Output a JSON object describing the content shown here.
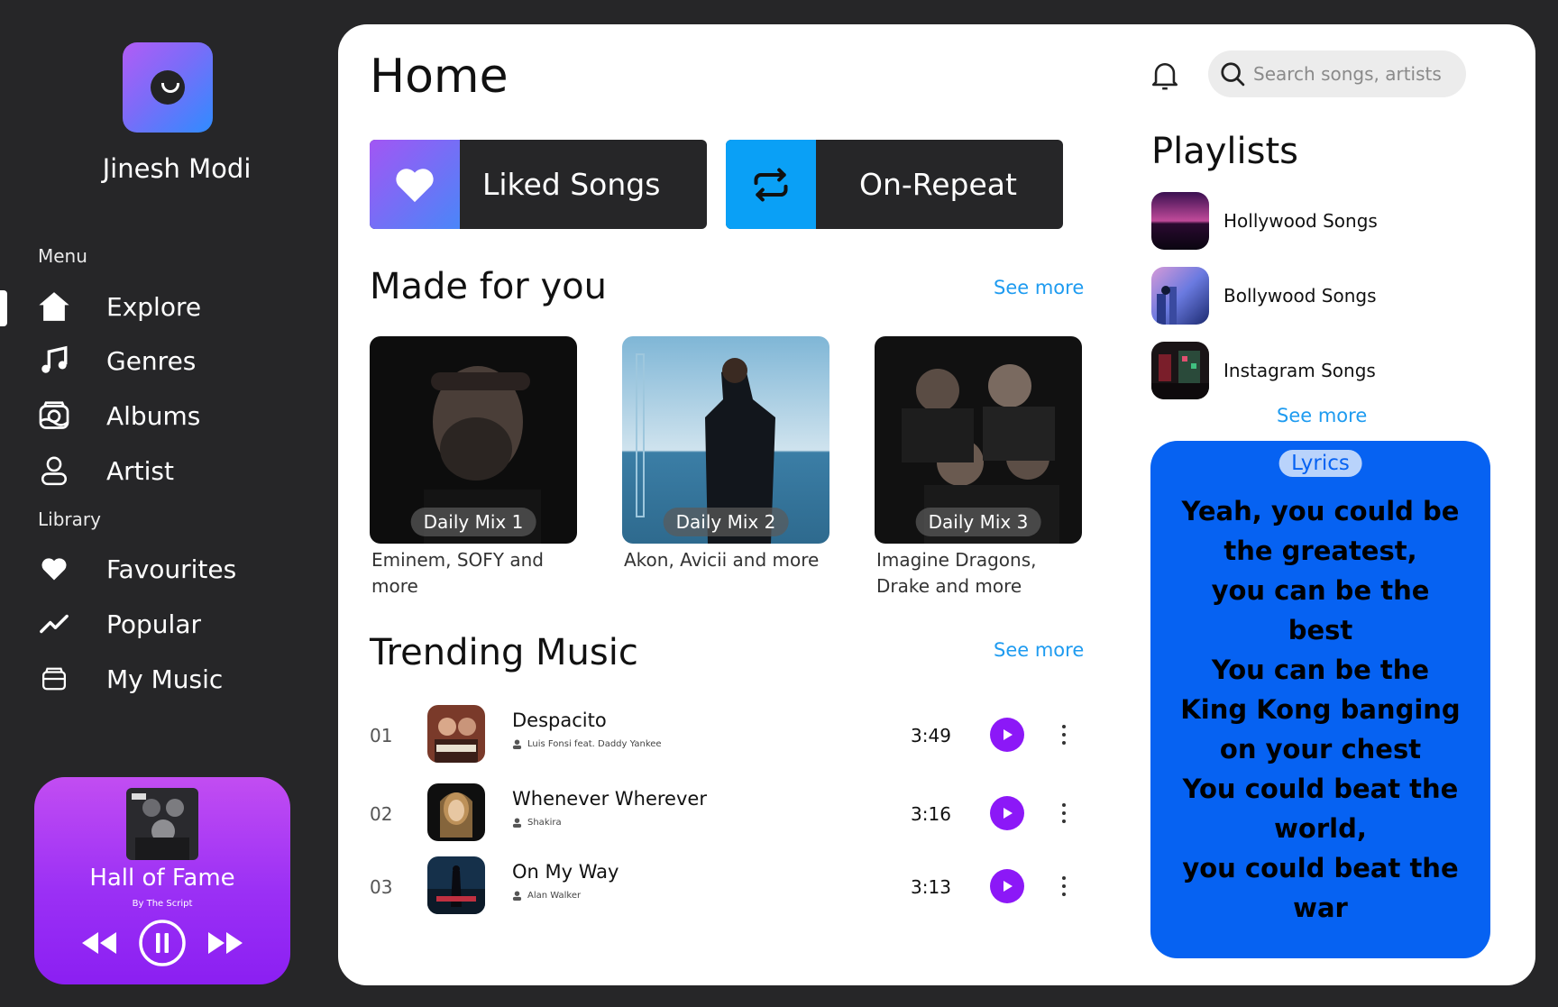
{
  "user": {
    "name": "Jinesh Modi"
  },
  "menu": {
    "label": "Menu",
    "items": [
      {
        "label": "Explore",
        "icon": "home-icon"
      },
      {
        "label": "Genres",
        "icon": "music-note-icon"
      },
      {
        "label": "Albums",
        "icon": "album-icon"
      },
      {
        "label": "Artist",
        "icon": "user-icon"
      }
    ]
  },
  "library": {
    "label": "Library",
    "items": [
      {
        "label": "Favourites",
        "icon": "heart-icon"
      },
      {
        "label": "Popular",
        "icon": "trend-icon"
      },
      {
        "label": "My Music",
        "icon": "folder-icon"
      }
    ]
  },
  "now_playing": {
    "title": "Hall of Fame",
    "artist": "By The Script"
  },
  "header": {
    "title": "Home",
    "search_placeholder": "Search songs, artists"
  },
  "quick_access": [
    {
      "label": "Liked Songs",
      "icon": "heart-icon",
      "color": "#8e63f6"
    },
    {
      "label": "On-Repeat",
      "icon": "repeat-icon",
      "color": "#0aa0f6"
    }
  ],
  "made_for_you": {
    "title": "Made for you",
    "see_more": "See more",
    "mixes": [
      {
        "label": "Daily Mix 1",
        "desc": "Eminem, SOFY and more"
      },
      {
        "label": "Daily Mix 2",
        "desc": "Akon, Avicii and more"
      },
      {
        "label": "Daily Mix 3",
        "desc": "Imagine Dragons, Drake and more"
      }
    ]
  },
  "trending": {
    "title": "Trending Music",
    "see_more": "See more",
    "tracks": [
      {
        "num": "01",
        "name": "Despacito",
        "artist": "Luis Fonsi feat. Daddy Yankee",
        "duration": "3:49"
      },
      {
        "num": "02",
        "name": "Whenever Wherever",
        "artist": "Shakira",
        "duration": "3:16"
      },
      {
        "num": "03",
        "name": "On My Way",
        "artist": "Alan Walker",
        "duration": "3:13"
      }
    ]
  },
  "playlists": {
    "title": "Playlists",
    "see_more": "See more",
    "items": [
      {
        "name": "Hollywood Songs"
      },
      {
        "name": "Bollywood Songs"
      },
      {
        "name": "Instagram Songs"
      }
    ]
  },
  "lyrics": {
    "badge": "Lyrics",
    "text": "Yeah, you could be\nthe greatest,\nyou can be the\nbest\nYou can be the\nKing Kong banging\non your chest\nYou could beat the\nworld,\nyou could beat the\nwar"
  },
  "colors": {
    "accent": "#8c18f7",
    "link": "#1e9bf0",
    "lyrics_bg": "#0662f2",
    "sidebar_bg": "#262628"
  }
}
